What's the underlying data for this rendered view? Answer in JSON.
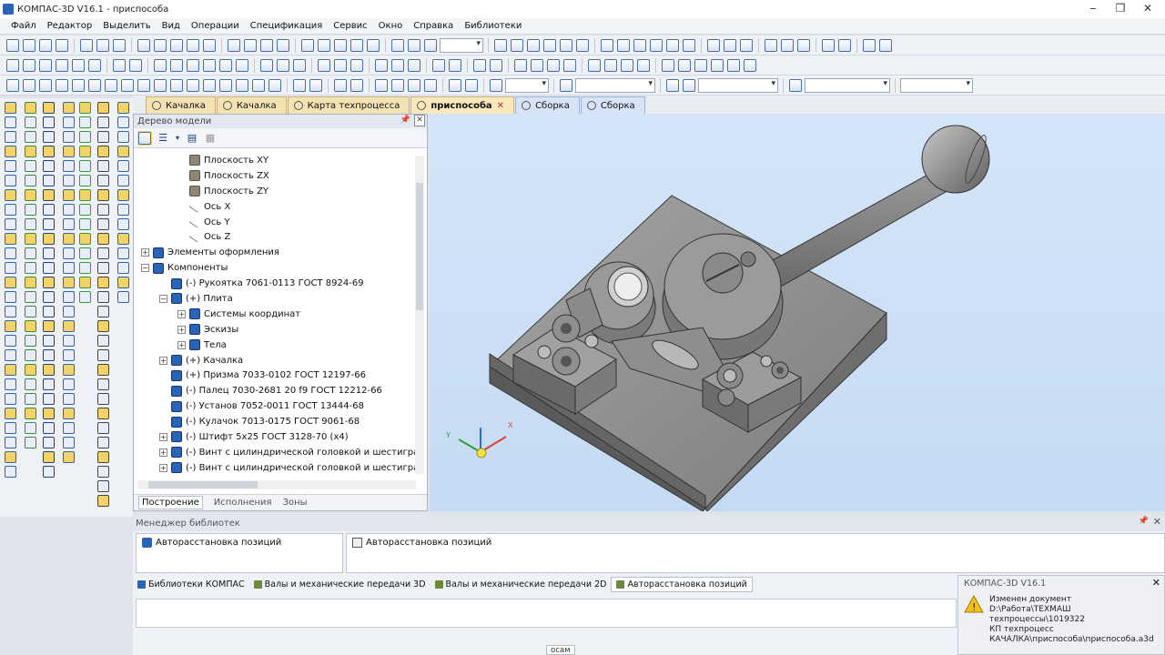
{
  "window": {
    "title": "КОМПАС-3D V16.1 - приспособа"
  },
  "menu": [
    "Файл",
    "Редактор",
    "Выделить",
    "Вид",
    "Операции",
    "Спецификация",
    "Сервис",
    "Окно",
    "Справка",
    "Библиотеки"
  ],
  "doc_tabs": [
    {
      "label": "Качалка",
      "style": "yellow"
    },
    {
      "label": "Качалка",
      "style": "yellow"
    },
    {
      "label": "Карта техпроцесса",
      "style": "yellow"
    },
    {
      "label": "приспособа",
      "style": "active"
    },
    {
      "label": "Сборка",
      "style": "blue"
    },
    {
      "label": "Сборка",
      "style": "blue"
    }
  ],
  "tree": {
    "title": "Дерево модели",
    "rows": [
      {
        "label": "Плоскость XY",
        "level": 3,
        "icon": "plane-icon"
      },
      {
        "label": "Плоскость ZX",
        "level": 3,
        "icon": "plane-icon"
      },
      {
        "label": "Плоскость ZY",
        "level": 3,
        "icon": "plane-icon"
      },
      {
        "label": "Ось X",
        "level": 3,
        "icon": "axis-icon"
      },
      {
        "label": "Ось Y",
        "level": 3,
        "icon": "axis-icon"
      },
      {
        "label": "Ось Z",
        "level": 3,
        "icon": "axis-icon"
      },
      {
        "label": "Элементы оформления",
        "level": 1,
        "icon": "annotation-icon",
        "expander": "+"
      },
      {
        "label": "Компоненты",
        "level": 1,
        "icon": "components-icon",
        "expander": "−"
      },
      {
        "label": "(-) Рукоятка 7061-0113 ГОСТ 8924-69",
        "level": 2,
        "icon": "part-icon"
      },
      {
        "label": "(+) Плита",
        "level": 2,
        "icon": "assembly-icon",
        "expander": "−"
      },
      {
        "label": "Системы координат",
        "level": 3,
        "icon": "coord-icon",
        "expander": "+"
      },
      {
        "label": "Эскизы",
        "level": 3,
        "icon": "sketch-icon",
        "expander": "+"
      },
      {
        "label": "Тела",
        "level": 3,
        "icon": "body-icon",
        "expander": "+"
      },
      {
        "label": "(+) Качалка",
        "level": 2,
        "icon": "assembly-icon",
        "expander": "+"
      },
      {
        "label": "(+) Призма 7033-0102 ГОСТ 12197-66",
        "level": 2,
        "icon": "part-icon"
      },
      {
        "label": "(-) Палец 7030-2681 20 f9 ГОСТ 12212-66",
        "level": 2,
        "icon": "part-icon"
      },
      {
        "label": "(-) Установ 7052-0011 ГОСТ 13444-68",
        "level": 2,
        "icon": "part-icon"
      },
      {
        "label": "(-) Кулачок 7013-0175 ГОСТ 9061-68",
        "level": 2,
        "icon": "part-icon"
      },
      {
        "label": "(-) Штифт 5х25 ГОСТ 3128-70 (х4)",
        "level": 2,
        "icon": "part-icon",
        "expander": "+"
      },
      {
        "label": "(-) Винт с цилиндрической головкой и шестигранны",
        "level": 2,
        "icon": "part-icon",
        "expander": "+"
      },
      {
        "label": "(-) Винт с цилиндрической головкой и шестигранны",
        "level": 2,
        "icon": "part-icon",
        "expander": "+"
      }
    ],
    "bottom_tabs": [
      "Построение",
      "Исполнения",
      "Зоны"
    ]
  },
  "library": {
    "title": "Менеджер библиотек",
    "left_item": "Авторасстановка позиций",
    "right_item": "Авторасстановка позиций",
    "tabs": [
      {
        "label": "Библиотеки КОМПАС",
        "active": false
      },
      {
        "label": "Валы и механические передачи 3D",
        "active": false
      },
      {
        "label": "Валы и механические передачи 2D",
        "active": false
      },
      {
        "label": "Авторасстановка позиций",
        "active": true
      }
    ]
  },
  "notification": {
    "title": "КОМПАС-3D V16.1",
    "line1": "Изменен документ",
    "line2": "D:\\Работа\\ТЕХМАШ техпроцессы\\1019322",
    "line3": "КП техпроцесс",
    "line4": "КАЧАЛКА\\приспособа\\приспособа.a3d"
  },
  "status": {
    "label": "осам"
  },
  "colors": {
    "accent": "#2a63b8",
    "model_gray": "#8d8d8d",
    "viewport_bg": "#cfe0f5"
  }
}
